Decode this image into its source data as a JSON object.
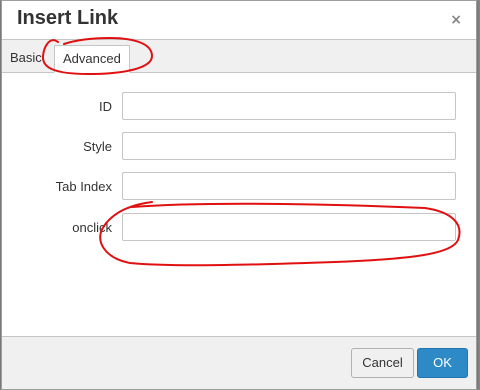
{
  "dialog": {
    "title": "Insert Link",
    "close_glyph": "×",
    "tabs": [
      {
        "label": "Basic",
        "active": false
      },
      {
        "label": "Advanced",
        "active": true
      }
    ],
    "fields": [
      {
        "label": "ID",
        "value": ""
      },
      {
        "label": "Style",
        "value": ""
      },
      {
        "label": "Tab Index",
        "value": ""
      },
      {
        "label": "onclick",
        "value": ""
      }
    ],
    "buttons": {
      "cancel": "Cancel",
      "ok": "OK"
    }
  },
  "colors": {
    "ok_button": "#2d8ac7",
    "annotation": "#e01010"
  }
}
